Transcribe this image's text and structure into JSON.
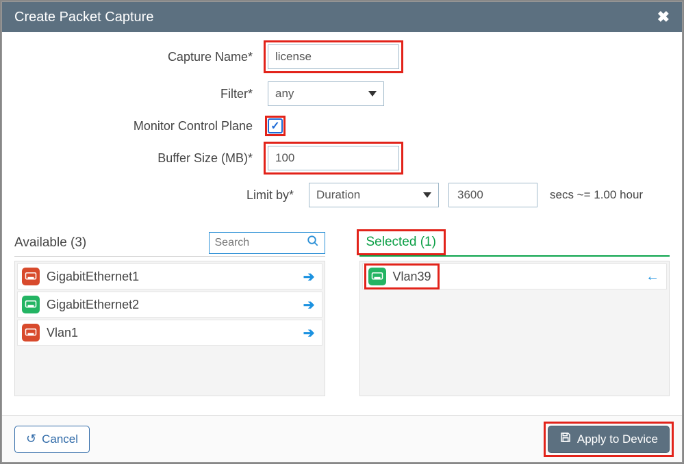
{
  "header": {
    "title": "Create Packet Capture"
  },
  "form": {
    "capture_name": {
      "label": "Capture Name*",
      "value": "license"
    },
    "filter": {
      "label": "Filter*",
      "value": "any"
    },
    "monitor_cp": {
      "label": "Monitor Control Plane",
      "checked": true
    },
    "buffer_size": {
      "label": "Buffer Size (MB)*",
      "value": "100"
    },
    "limit_by": {
      "label": "Limit by*",
      "value": "Duration",
      "seconds": "3600",
      "hint": "secs ~= 1.00 hour"
    }
  },
  "available": {
    "title": "Available (3)",
    "search_placeholder": "Search",
    "items": [
      {
        "name": "GigabitEthernet1",
        "color": "red"
      },
      {
        "name": "GigabitEthernet2",
        "color": "green"
      },
      {
        "name": "Vlan1",
        "color": "red"
      }
    ]
  },
  "selected": {
    "title": "Selected (1)",
    "items": [
      {
        "name": "Vlan39",
        "color": "green"
      }
    ]
  },
  "footer": {
    "cancel": "Cancel",
    "apply": "Apply to Device"
  }
}
